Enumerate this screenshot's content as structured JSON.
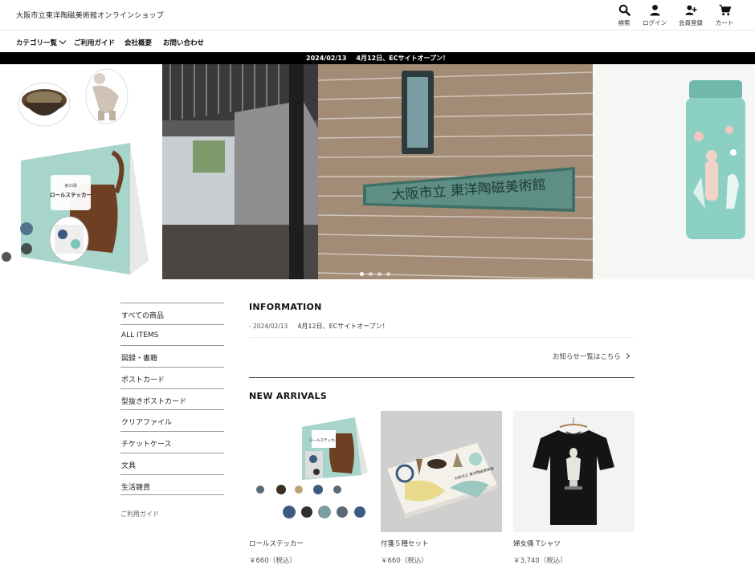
{
  "header": {
    "site_title": "大阪市立東洋陶磁美術館オンラインショップ",
    "utility": [
      {
        "label": "検索",
        "icon": "search-icon"
      },
      {
        "label": "ログイン",
        "icon": "user-icon"
      },
      {
        "label": "会員登録",
        "icon": "user-plus-icon"
      },
      {
        "label": "カート",
        "icon": "cart-icon"
      }
    ]
  },
  "nav": {
    "items": [
      "カテゴリ一覧",
      "ご利用ガイド",
      "会社概要",
      "お問い合わせ"
    ]
  },
  "announcement": {
    "date": "2024/02/13",
    "text": "4月12日、ECサイトオープン！"
  },
  "hero": {
    "sign_text": "大阪市立 東洋陶磁美術館",
    "sticker_box_text": [
      "第23弾",
      "ロールステッカー"
    ],
    "slide_count": 4,
    "active_slide": 0
  },
  "sidebar": {
    "items": [
      "すべての商品",
      "ALL ITEMS",
      "図録・書籍",
      "ポストカード",
      "型抜きポストカード",
      "クリアファイル",
      "チケットケース",
      "文具",
      "生活雑貨"
    ],
    "guide": "ご利用ガイド"
  },
  "information": {
    "title": "INFORMATION",
    "items": [
      {
        "date": "- 2024/02/13",
        "text": "4月12日、ECサイトオープン！"
      }
    ],
    "more_link": "お知らせ一覧はこちら"
  },
  "new_arrivals": {
    "title": "NEW ARRIVALS",
    "products": [
      {
        "name": "ロールステッカー",
        "price": "￥660（税込）",
        "box_text": "ロールステッカー"
      },
      {
        "name": "付箋５種セット",
        "price": "￥660（税込）"
      },
      {
        "name": "婦女俑 Tシャツ",
        "price": "￥3,740（税込）"
      }
    ]
  },
  "colors": {
    "accent_teal": "#7fc4b8",
    "brown": "#6e3f22",
    "announce_bg": "#000000"
  }
}
